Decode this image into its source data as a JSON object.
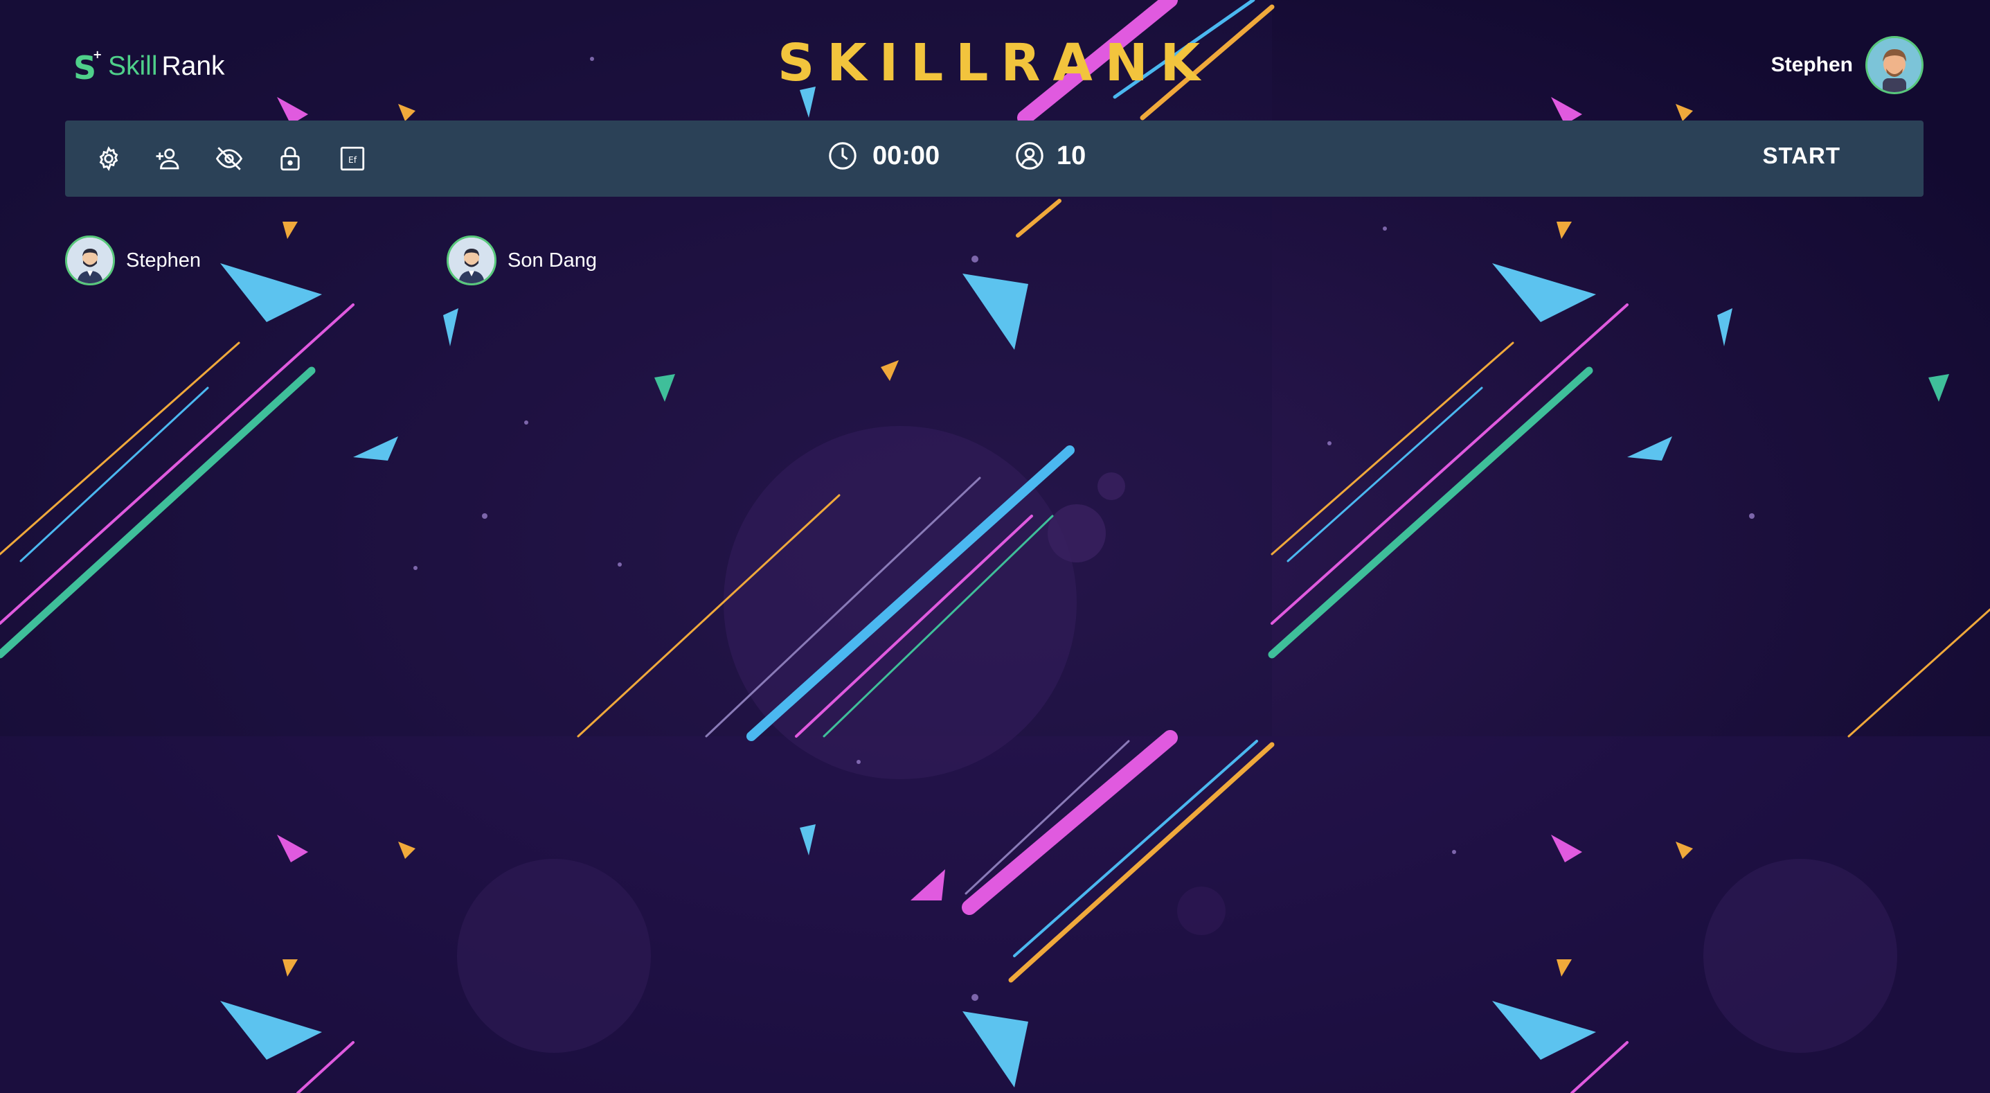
{
  "brand": {
    "logo_part1": "Skill",
    "logo_part2": "Rank",
    "title": "SKILLRANK"
  },
  "user": {
    "name": "Stephen"
  },
  "toolbar": {
    "icons": [
      "settings-icon",
      "add-user-icon",
      "eye-off-icon",
      "lock-icon",
      "ef-box-icon"
    ],
    "ef_label": "Ef",
    "timer": "00:00",
    "player_count": "10",
    "start_label": "START"
  },
  "players": [
    {
      "name": "Stephen"
    },
    {
      "name": "Son Dang"
    }
  ],
  "colors": {
    "background": "#150c36",
    "toolbar": "#2b4157",
    "brand_yellow": "#f2c43d",
    "logo_green": "#4fd08a",
    "avatar_border": "#58c87b"
  }
}
